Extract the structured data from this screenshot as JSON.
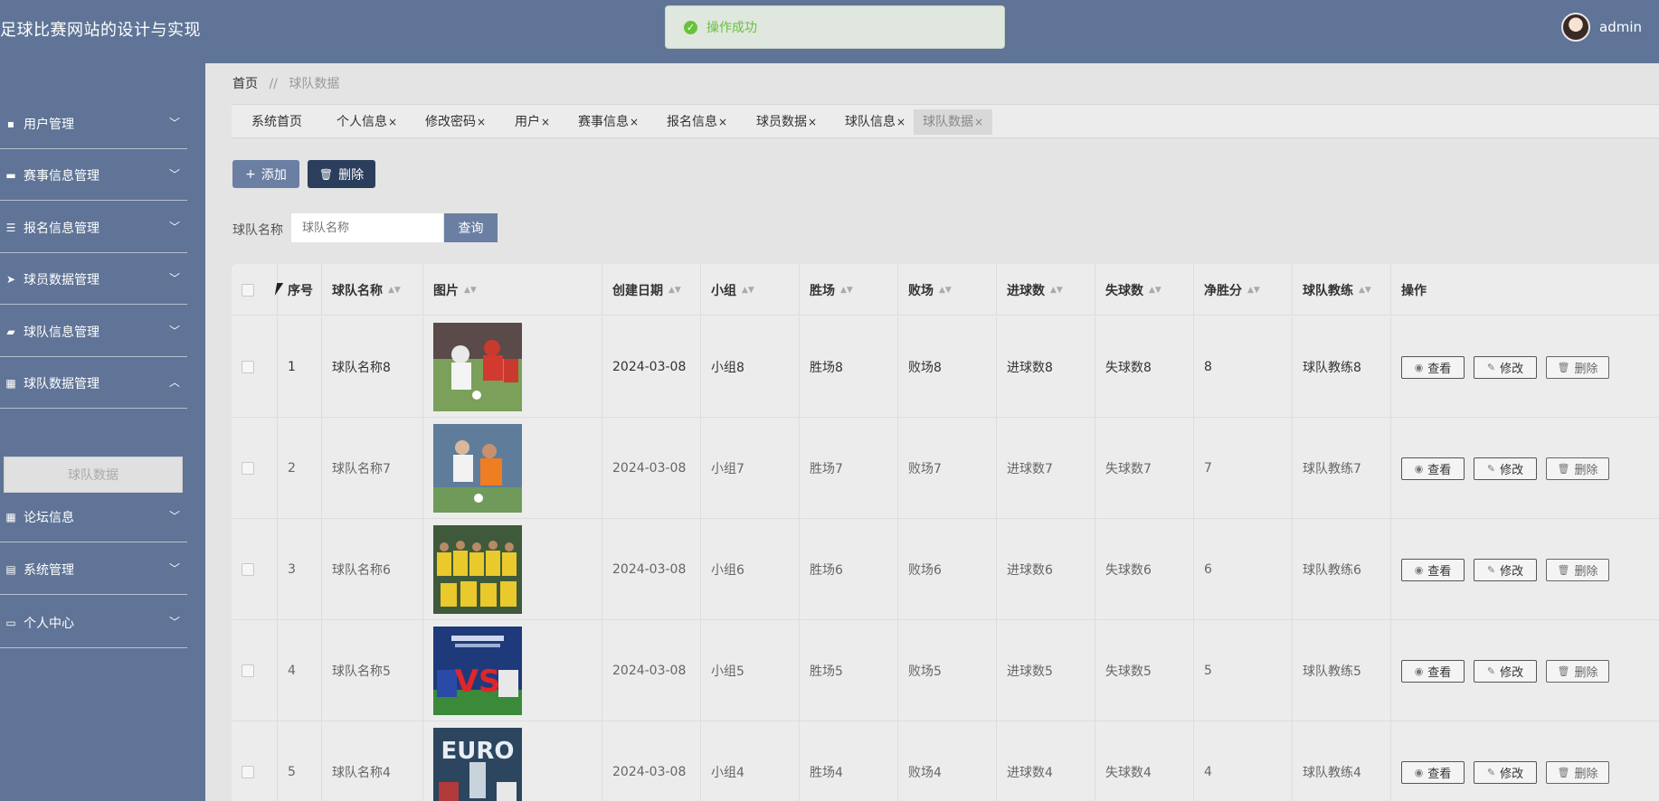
{
  "header": {
    "title": "足球比赛网站的设计与实现",
    "toast": "操作成功",
    "username": "admin"
  },
  "sidebar": {
    "items": [
      {
        "label": "用户管理",
        "icon": "chat-icon",
        "expanded": false
      },
      {
        "label": "赛事信息管理",
        "icon": "briefcase-icon",
        "expanded": false
      },
      {
        "label": "报名信息管理",
        "icon": "list-icon",
        "expanded": false
      },
      {
        "label": "球员数据管理",
        "icon": "paper-plane-icon",
        "expanded": false
      },
      {
        "label": "球队信息管理",
        "icon": "ticket-icon",
        "expanded": false
      },
      {
        "label": "球队数据管理",
        "icon": "grid-icon",
        "expanded": true
      },
      {
        "label": "论坛信息",
        "icon": "grid-icon",
        "expanded": false
      },
      {
        "label": "系统管理",
        "icon": "clipboard-icon",
        "expanded": false
      },
      {
        "label": "个人中心",
        "icon": "window-icon",
        "expanded": false
      }
    ],
    "active_sub": "球队数据"
  },
  "breadcrumb": {
    "home": "首页",
    "sep": "//",
    "current": "球队数据"
  },
  "tabs": [
    {
      "label": "系统首页",
      "closable": false
    },
    {
      "label": "个人信息",
      "closable": true
    },
    {
      "label": "修改密码",
      "closable": true
    },
    {
      "label": "用户",
      "closable": true
    },
    {
      "label": "赛事信息",
      "closable": true
    },
    {
      "label": "报名信息",
      "closable": true
    },
    {
      "label": "球员数据",
      "closable": true
    },
    {
      "label": "球队信息",
      "closable": true
    },
    {
      "label": "球队数据",
      "closable": true,
      "active": true
    }
  ],
  "toolbar": {
    "add_label": "添加",
    "delete_label": "删除"
  },
  "search": {
    "label": "球队名称",
    "placeholder": "球队名称",
    "button": "查询"
  },
  "table": {
    "headers": [
      "序号",
      "球队名称",
      "图片",
      "创建日期",
      "小组",
      "胜场",
      "败场",
      "进球数",
      "失球数",
      "净胜分",
      "球队教练",
      "操作"
    ],
    "rows": [
      {
        "index": "1",
        "name": "球队名称8",
        "image": "match-photo-red-white",
        "date": "2024-03-08",
        "group": "小组8",
        "wins": "胜场8",
        "losses": "败场8",
        "goals": "进球数8",
        "conceded": "失球数8",
        "net": "8",
        "coach": "球队教练8"
      },
      {
        "index": "2",
        "name": "球队名称7",
        "image": "match-photo-orange-white",
        "date": "2024-03-08",
        "group": "小组7",
        "wins": "胜场7",
        "losses": "败场7",
        "goals": "进球数7",
        "conceded": "失球数7",
        "net": "7",
        "coach": "球队教练7"
      },
      {
        "index": "3",
        "name": "球队名称6",
        "image": "team-photo-yellow",
        "date": "2024-03-08",
        "group": "小组6",
        "wins": "胜场6",
        "losses": "败场6",
        "goals": "进球数6",
        "conceded": "失球数6",
        "net": "6",
        "coach": "球队教练6"
      },
      {
        "index": "4",
        "name": "球队名称5",
        "image": "vs-poster",
        "date": "2024-03-08",
        "group": "小组5",
        "wins": "胜场5",
        "losses": "败场5",
        "goals": "进球数5",
        "conceded": "失球数5",
        "net": "5",
        "coach": "球队教练5"
      },
      {
        "index": "5",
        "name": "球队名称4",
        "image": "euro-poster",
        "date": "2024-03-08",
        "group": "小组4",
        "wins": "胜场4",
        "losses": "败场4",
        "goals": "进球数4",
        "conceded": "失球数4",
        "net": "4",
        "coach": "球队教练4"
      }
    ],
    "actions": {
      "view": "查看",
      "edit": "修改",
      "delete": "删除"
    }
  },
  "poster_text": {
    "vs": "VS",
    "euro": "EURO"
  }
}
